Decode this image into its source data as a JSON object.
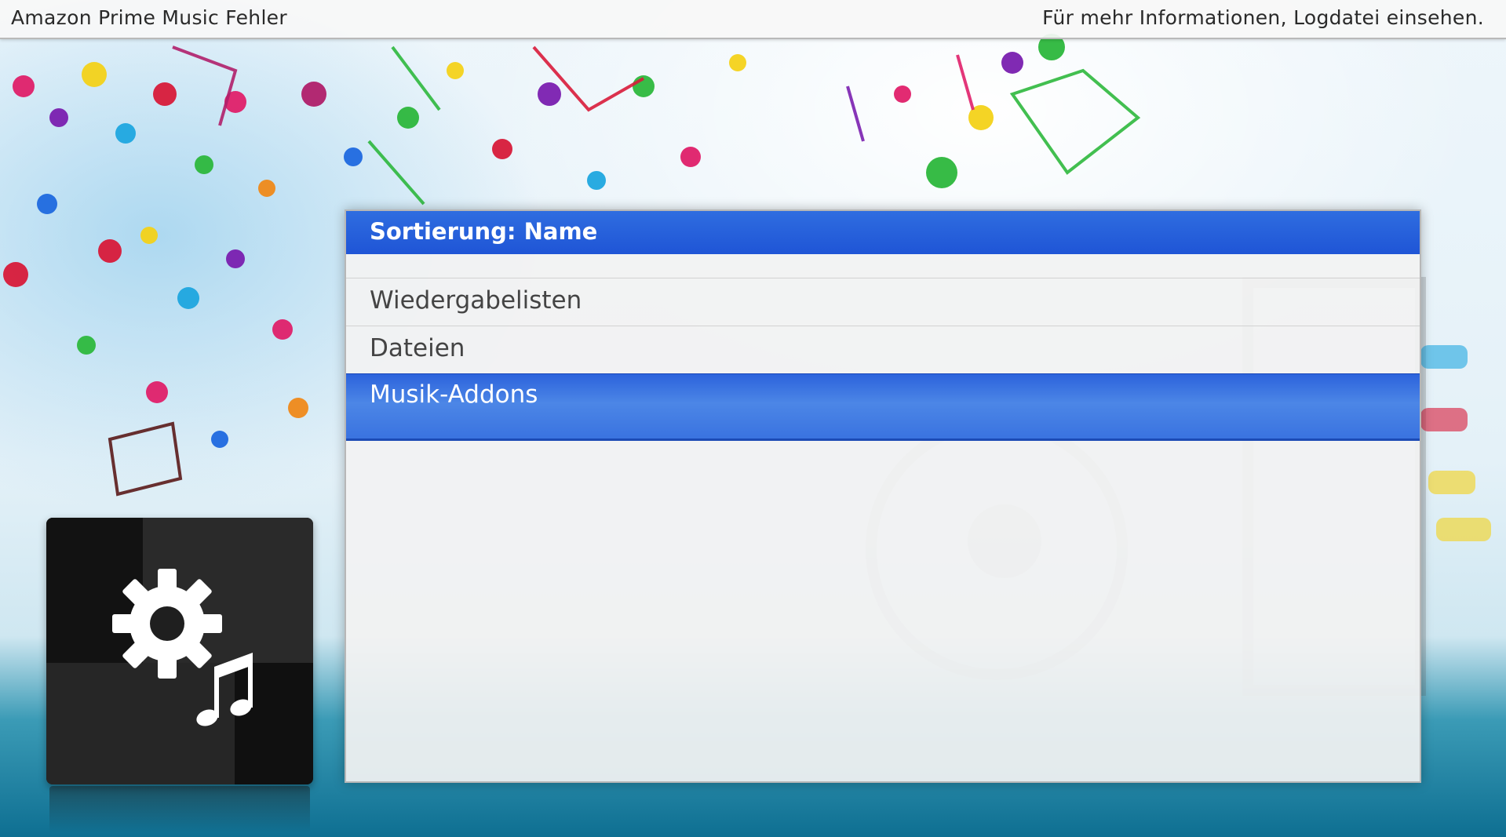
{
  "topbar": {
    "title": "Amazon Prime Music Fehler",
    "hint": "Für mehr Informationen, Logdatei einsehen."
  },
  "dialog": {
    "header": "Sortierung: Name",
    "items": [
      {
        "label": "Wiedergabelisten",
        "selected": false
      },
      {
        "label": "Dateien",
        "selected": false
      },
      {
        "label": "Musik-Addons",
        "selected": true
      }
    ]
  },
  "icon_tile": {
    "icon": "gear-music-note-icon"
  },
  "colors": {
    "accent": "#1f55d6",
    "selected_row": "#3a73e0",
    "dialog_bg": "#f2f2f2",
    "tile_bg": "#1f1f1f"
  }
}
